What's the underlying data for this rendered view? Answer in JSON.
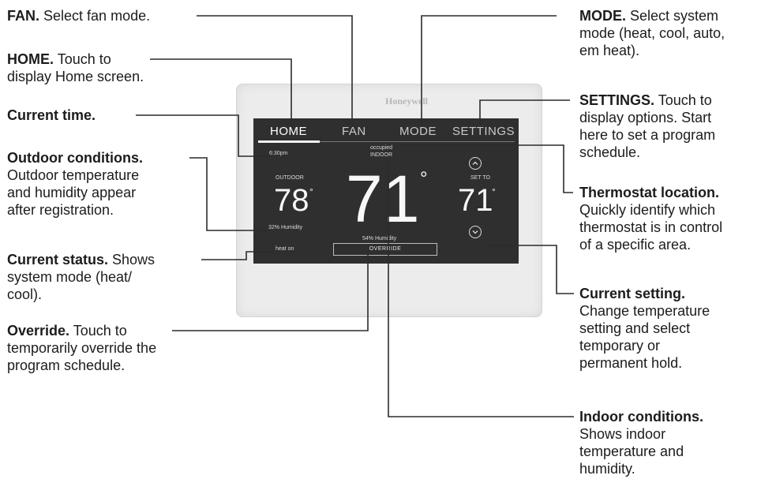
{
  "device": {
    "brand": "Honeywell",
    "tabs": {
      "home": "HOME",
      "fan": "FAN",
      "mode": "MODE",
      "settings": "SETTINGS"
    },
    "time": "6:30pm",
    "occupancy": "occupied",
    "location": "INDOOR",
    "outdoor_label": "OUTDOOR",
    "outdoor_temp": "78",
    "outdoor_humidity": "32% Humidity",
    "indoor_temp": "71",
    "indoor_humidity": "54% Humidity",
    "set_to_label": "SET TO",
    "set_temp": "71",
    "degree_symbol": "°",
    "status": "heat on",
    "override_label": "OVERRIDE"
  },
  "callouts": {
    "fan": {
      "title": "FAN.",
      "text": " Select fan mode."
    },
    "home": {
      "title": "HOME.",
      "text": " Touch to",
      "line2": "display Home screen."
    },
    "current_time": {
      "title": "Current time."
    },
    "outdoor": {
      "title": "Outdoor conditions.",
      "line2": "Outdoor temperature",
      "line3": "and humidity appear",
      "line4": "after registration."
    },
    "status": {
      "title": "Current status.",
      "text": " Shows",
      "line2": "system mode (heat/",
      "line3": "cool)."
    },
    "override": {
      "title": "Override.",
      "text": " Touch to",
      "line2": "temporarily override the",
      "line3": "program schedule."
    },
    "mode": {
      "title": "MODE.",
      "text": " Select system",
      "line2": "mode (heat, cool, auto,",
      "line3": "em heat)."
    },
    "settings": {
      "title": "SETTINGS.",
      "text": " Touch to",
      "line2": "display options. Start",
      "line3": "here to set a program",
      "line4": "schedule."
    },
    "location": {
      "title": "Thermostat location.",
      "line2": "Quickly identify which",
      "line3": "thermostat is in control",
      "line4": "of a specific area."
    },
    "setting": {
      "title": "Current setting.",
      "line2": "Change temperature",
      "line3": "setting and select",
      "line4": "temporary or",
      "line5": "permanent hold."
    },
    "indoor": {
      "title": "Indoor conditions.",
      "line2": "Shows indoor",
      "line3": "temperature and",
      "line4": "humidity."
    }
  },
  "icons": {
    "up": "chevron-up-icon",
    "down": "chevron-down-icon"
  },
  "colors": {
    "screen": "#2f2f2f",
    "bezel": "#ececec",
    "text": "#1c1c1c"
  }
}
